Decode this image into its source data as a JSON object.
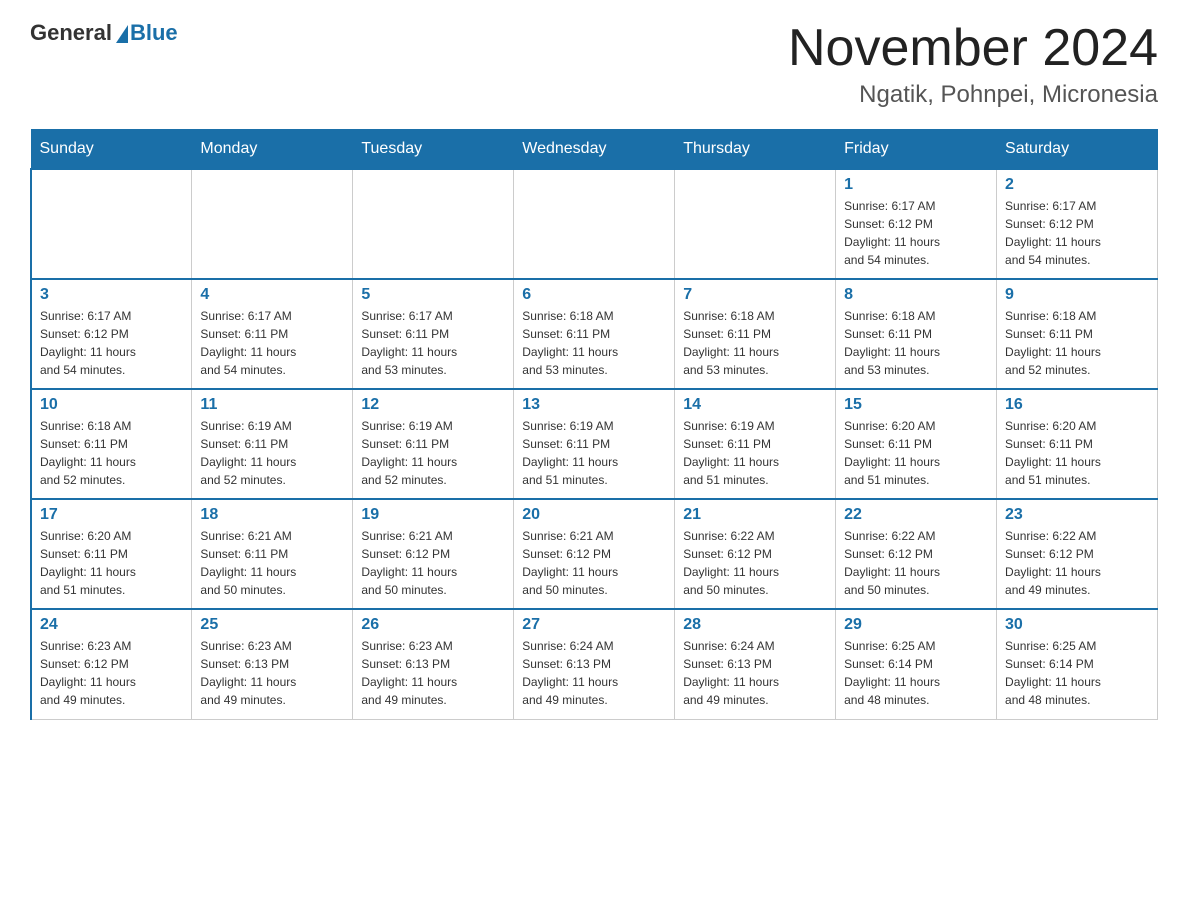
{
  "logo": {
    "general_text": "General",
    "blue_text": "Blue"
  },
  "header": {
    "title": "November 2024",
    "subtitle": "Ngatik, Pohnpei, Micronesia"
  },
  "weekdays": [
    "Sunday",
    "Monday",
    "Tuesday",
    "Wednesday",
    "Thursday",
    "Friday",
    "Saturday"
  ],
  "weeks": [
    [
      {
        "day": "",
        "info": ""
      },
      {
        "day": "",
        "info": ""
      },
      {
        "day": "",
        "info": ""
      },
      {
        "day": "",
        "info": ""
      },
      {
        "day": "",
        "info": ""
      },
      {
        "day": "1",
        "info": "Sunrise: 6:17 AM\nSunset: 6:12 PM\nDaylight: 11 hours\nand 54 minutes."
      },
      {
        "day": "2",
        "info": "Sunrise: 6:17 AM\nSunset: 6:12 PM\nDaylight: 11 hours\nand 54 minutes."
      }
    ],
    [
      {
        "day": "3",
        "info": "Sunrise: 6:17 AM\nSunset: 6:12 PM\nDaylight: 11 hours\nand 54 minutes."
      },
      {
        "day": "4",
        "info": "Sunrise: 6:17 AM\nSunset: 6:11 PM\nDaylight: 11 hours\nand 54 minutes."
      },
      {
        "day": "5",
        "info": "Sunrise: 6:17 AM\nSunset: 6:11 PM\nDaylight: 11 hours\nand 53 minutes."
      },
      {
        "day": "6",
        "info": "Sunrise: 6:18 AM\nSunset: 6:11 PM\nDaylight: 11 hours\nand 53 minutes."
      },
      {
        "day": "7",
        "info": "Sunrise: 6:18 AM\nSunset: 6:11 PM\nDaylight: 11 hours\nand 53 minutes."
      },
      {
        "day": "8",
        "info": "Sunrise: 6:18 AM\nSunset: 6:11 PM\nDaylight: 11 hours\nand 53 minutes."
      },
      {
        "day": "9",
        "info": "Sunrise: 6:18 AM\nSunset: 6:11 PM\nDaylight: 11 hours\nand 52 minutes."
      }
    ],
    [
      {
        "day": "10",
        "info": "Sunrise: 6:18 AM\nSunset: 6:11 PM\nDaylight: 11 hours\nand 52 minutes."
      },
      {
        "day": "11",
        "info": "Sunrise: 6:19 AM\nSunset: 6:11 PM\nDaylight: 11 hours\nand 52 minutes."
      },
      {
        "day": "12",
        "info": "Sunrise: 6:19 AM\nSunset: 6:11 PM\nDaylight: 11 hours\nand 52 minutes."
      },
      {
        "day": "13",
        "info": "Sunrise: 6:19 AM\nSunset: 6:11 PM\nDaylight: 11 hours\nand 51 minutes."
      },
      {
        "day": "14",
        "info": "Sunrise: 6:19 AM\nSunset: 6:11 PM\nDaylight: 11 hours\nand 51 minutes."
      },
      {
        "day": "15",
        "info": "Sunrise: 6:20 AM\nSunset: 6:11 PM\nDaylight: 11 hours\nand 51 minutes."
      },
      {
        "day": "16",
        "info": "Sunrise: 6:20 AM\nSunset: 6:11 PM\nDaylight: 11 hours\nand 51 minutes."
      }
    ],
    [
      {
        "day": "17",
        "info": "Sunrise: 6:20 AM\nSunset: 6:11 PM\nDaylight: 11 hours\nand 51 minutes."
      },
      {
        "day": "18",
        "info": "Sunrise: 6:21 AM\nSunset: 6:11 PM\nDaylight: 11 hours\nand 50 minutes."
      },
      {
        "day": "19",
        "info": "Sunrise: 6:21 AM\nSunset: 6:12 PM\nDaylight: 11 hours\nand 50 minutes."
      },
      {
        "day": "20",
        "info": "Sunrise: 6:21 AM\nSunset: 6:12 PM\nDaylight: 11 hours\nand 50 minutes."
      },
      {
        "day": "21",
        "info": "Sunrise: 6:22 AM\nSunset: 6:12 PM\nDaylight: 11 hours\nand 50 minutes."
      },
      {
        "day": "22",
        "info": "Sunrise: 6:22 AM\nSunset: 6:12 PM\nDaylight: 11 hours\nand 50 minutes."
      },
      {
        "day": "23",
        "info": "Sunrise: 6:22 AM\nSunset: 6:12 PM\nDaylight: 11 hours\nand 49 minutes."
      }
    ],
    [
      {
        "day": "24",
        "info": "Sunrise: 6:23 AM\nSunset: 6:12 PM\nDaylight: 11 hours\nand 49 minutes."
      },
      {
        "day": "25",
        "info": "Sunrise: 6:23 AM\nSunset: 6:13 PM\nDaylight: 11 hours\nand 49 minutes."
      },
      {
        "day": "26",
        "info": "Sunrise: 6:23 AM\nSunset: 6:13 PM\nDaylight: 11 hours\nand 49 minutes."
      },
      {
        "day": "27",
        "info": "Sunrise: 6:24 AM\nSunset: 6:13 PM\nDaylight: 11 hours\nand 49 minutes."
      },
      {
        "day": "28",
        "info": "Sunrise: 6:24 AM\nSunset: 6:13 PM\nDaylight: 11 hours\nand 49 minutes."
      },
      {
        "day": "29",
        "info": "Sunrise: 6:25 AM\nSunset: 6:14 PM\nDaylight: 11 hours\nand 48 minutes."
      },
      {
        "day": "30",
        "info": "Sunrise: 6:25 AM\nSunset: 6:14 PM\nDaylight: 11 hours\nand 48 minutes."
      }
    ]
  ]
}
